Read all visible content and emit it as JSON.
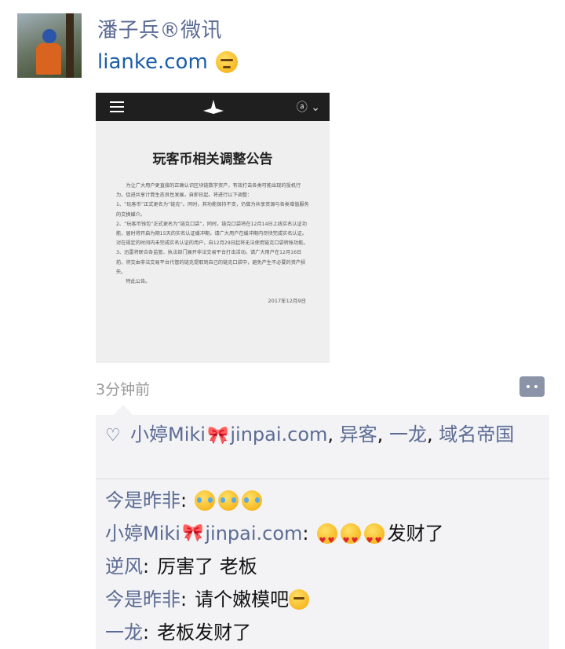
{
  "post": {
    "author": "潘子兵®微讯",
    "text": "lianke.com",
    "time_ago": "3分钟前"
  },
  "photo_notice": {
    "title": "玩客币相关调整公告",
    "intro": "为让广大用户更直接的正确认识区块链数字资产，有效打击各类可能出现的投机行为，促进共享计算生态良性发展，自即日起，将进行以下调整：",
    "item1": "1、“玩客币”正式更名为“链克”。同时，其功能保持不变，仍做为共享资源与各类增值服务的交换媒介。",
    "item2": "2、“玩客币钱包”正式更名为“链克口袋”，同时，链克口袋将在12月14日上线实名认证功能，届时将开启为期15天的实名认证缓冲期，请广大用户在缓冲期内尽快完成实名认证。对在规定的时间内未完成实名认证的用户，自12月29日起将无法使用链克口袋转账功能。",
    "item3": "3、迅雷将联合各监管、执法部门展开非法交易平台打击活动。请广大用户在12月16日前，将交由非法交易平台代管的链克提取到自己的链克口袋中，避免产生不必要的资产损失。",
    "closing": "特此公告。",
    "date": "2017年12月9日"
  },
  "likes": {
    "label": "小婷Miki🎀jinpai.com, 异客, 一龙, 域名帝国",
    "names": [
      "小婷Miki",
      "jinpai.com",
      "异客",
      "一龙",
      "域名帝国"
    ]
  },
  "comments": [
    {
      "name": "今是昨非",
      "text": ""
    },
    {
      "name": "小婷Miki",
      "name_suffix": "jinpai.com",
      "text": "发财了"
    },
    {
      "name": "逆风",
      "text": "厉害了 老板"
    },
    {
      "name": "今是昨非",
      "text": "请个嫩模吧"
    },
    {
      "name": "一龙",
      "text": "老板发财了"
    }
  ],
  "colors": {
    "name_blue": "#5b6b94",
    "link_blue": "#1b5ea7",
    "time_gray": "#9a9a9a",
    "panel_bg": "#f3f3f5"
  }
}
